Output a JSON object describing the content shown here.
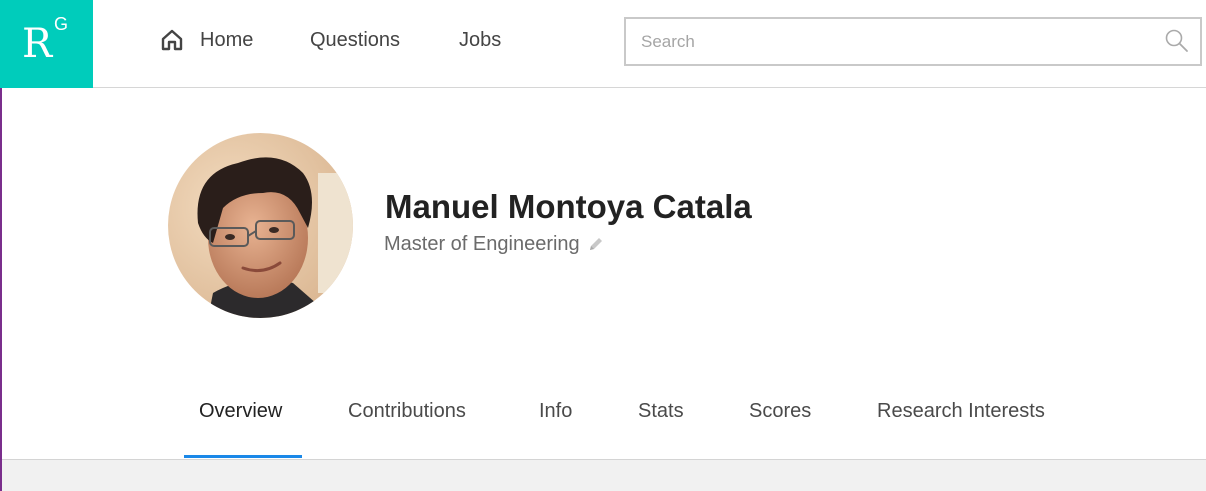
{
  "logo": {
    "main": "R",
    "sup": "G"
  },
  "nav": {
    "home": "Home",
    "questions": "Questions",
    "jobs": "Jobs"
  },
  "search": {
    "placeholder": "Search",
    "value": ""
  },
  "profile": {
    "name": "Manuel Montoya Catala",
    "degree": "Master of Engineering"
  },
  "tabs": [
    {
      "label": "Overview",
      "active": true
    },
    {
      "label": "Contributions",
      "active": false
    },
    {
      "label": "Info",
      "active": false
    },
    {
      "label": "Stats",
      "active": false
    },
    {
      "label": "Scores",
      "active": false
    },
    {
      "label": "Research Interests",
      "active": false
    }
  ],
  "colors": {
    "brand": "#00ccbb",
    "active_tab": "#1a88e8",
    "left_edge": "#7a2e8c"
  },
  "icons": {
    "home": "home-icon",
    "search": "search-icon",
    "edit": "pencil-icon"
  }
}
